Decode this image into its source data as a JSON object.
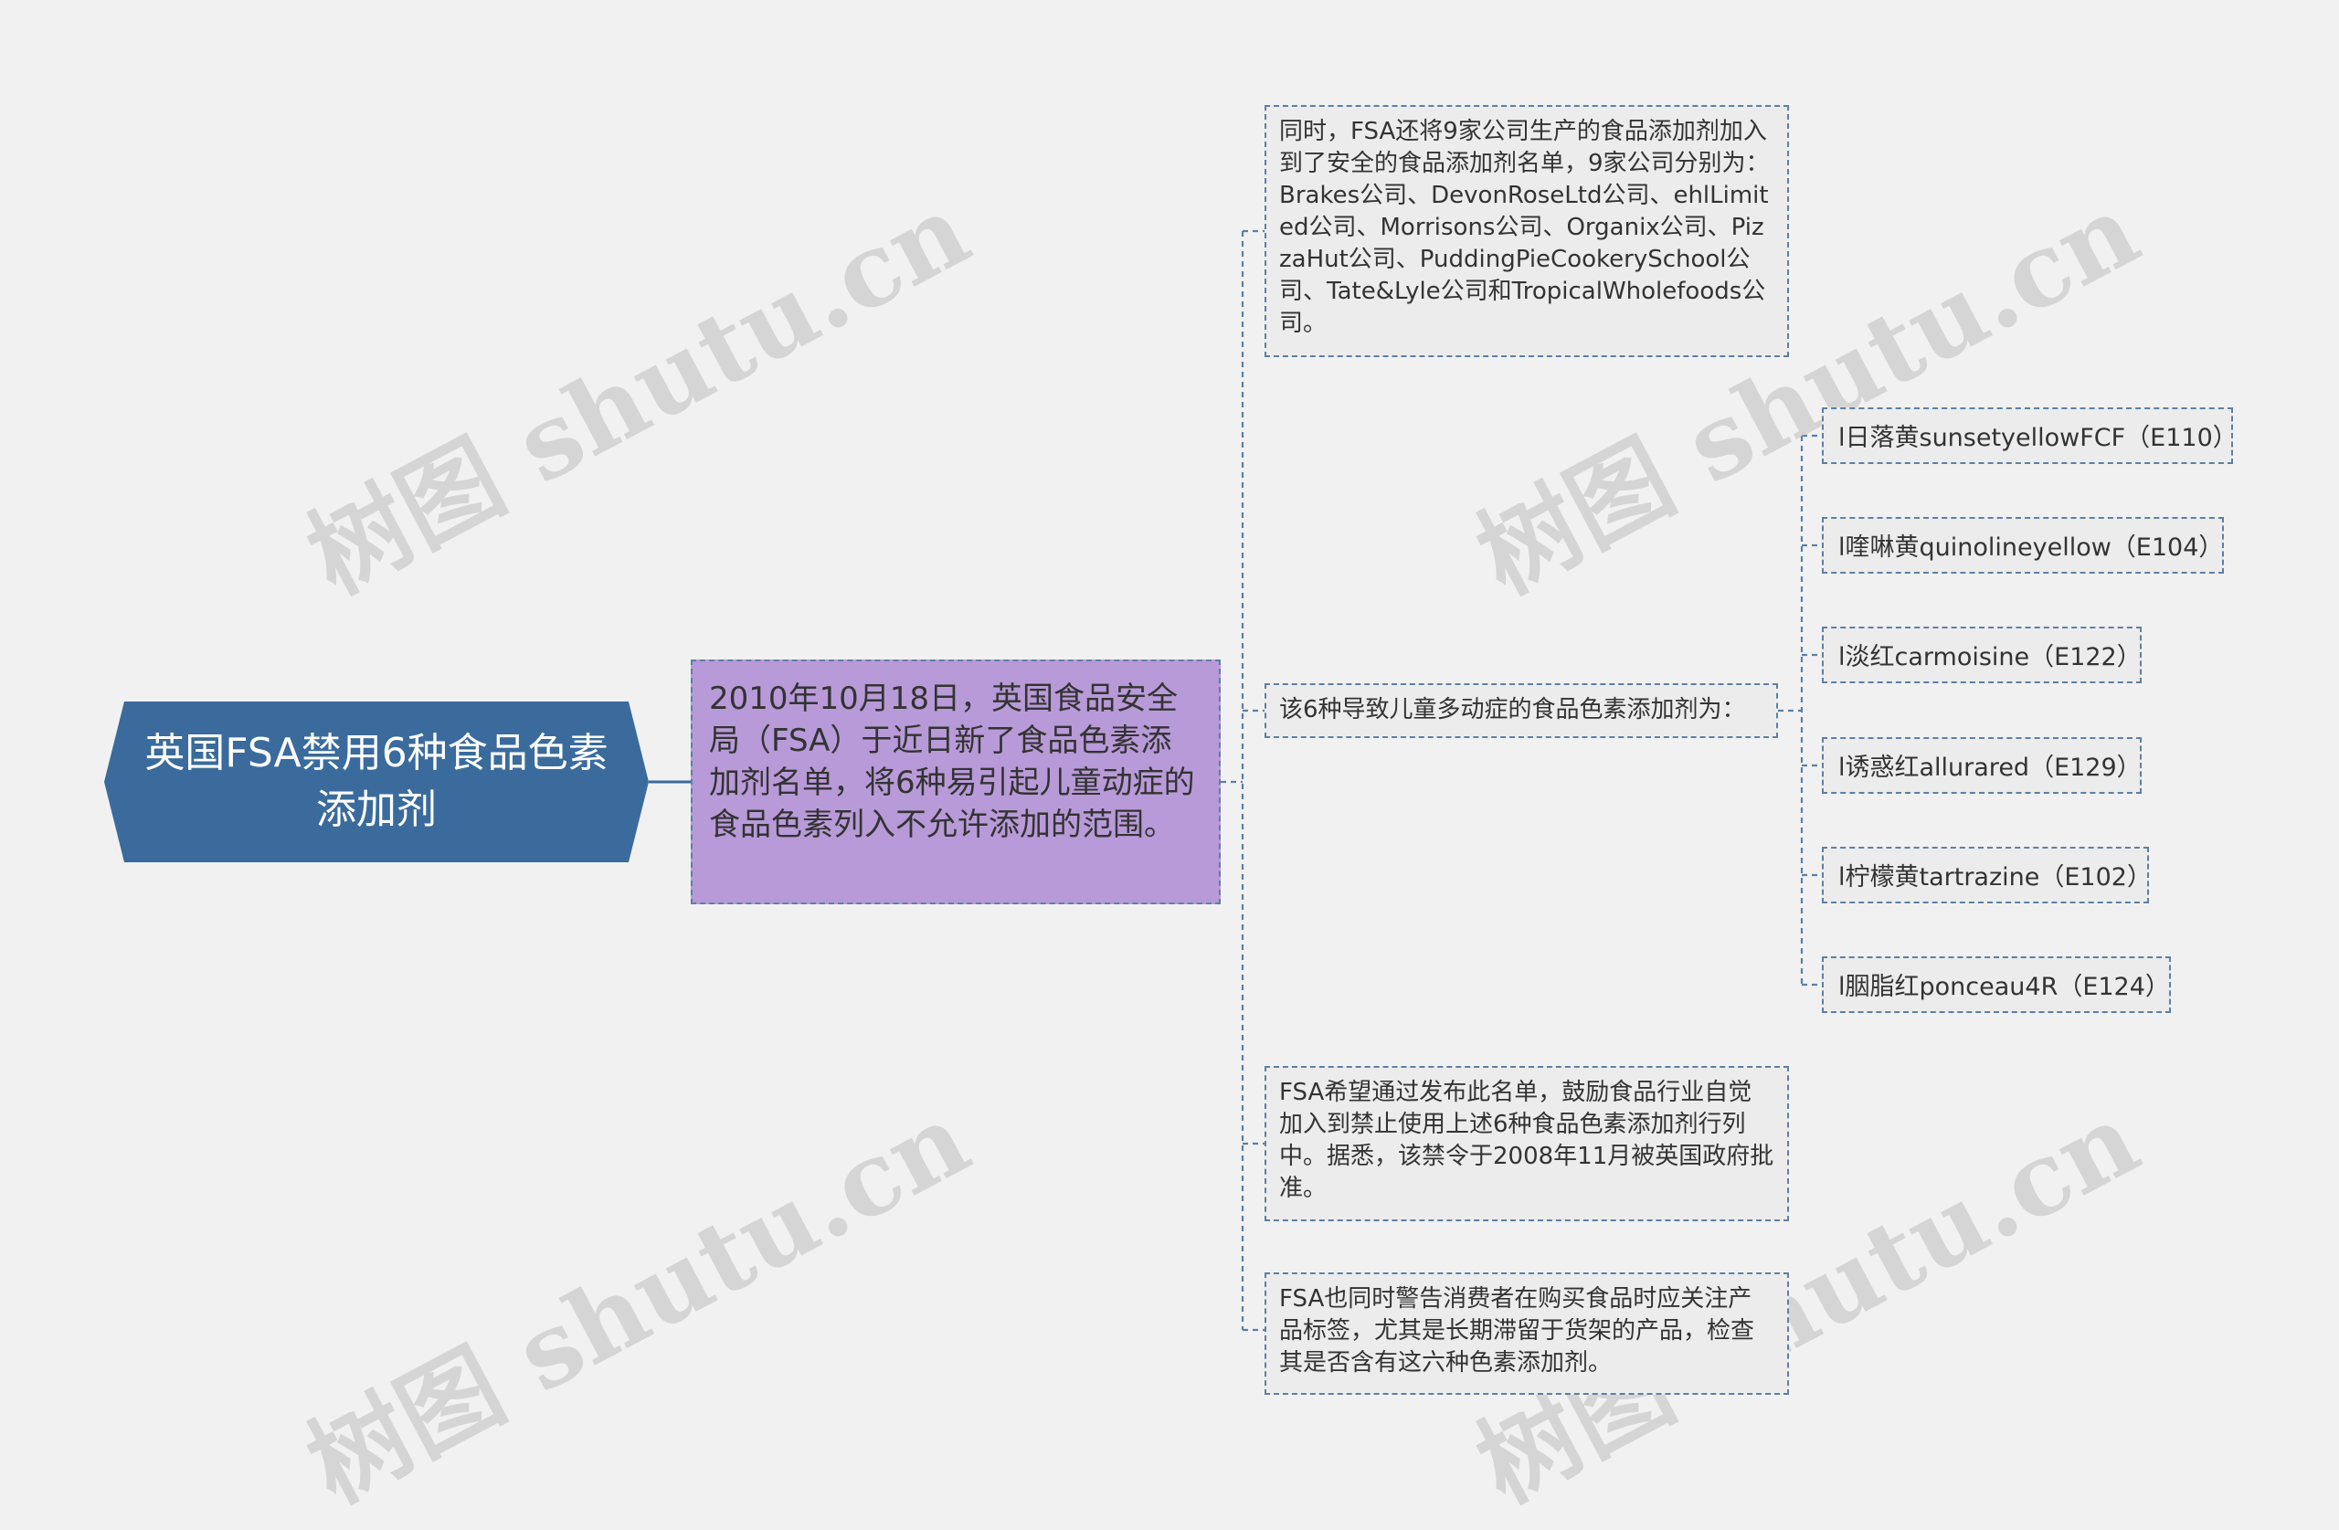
{
  "root": {
    "label": "英国FSA禁用6种食品色素添加剂"
  },
  "main": {
    "text": "2010年10月18日，英国食品安全局（FSA）于近日新了食品色素添加剂名单，将6种易引起儿童动症的食品色素列入不允许添加的范围。"
  },
  "branches": [
    {
      "text": "同时，FSA还将9家公司生产的食品添加剂加入到了安全的食品添加剂名单，9家公司分别为：Brakes公司、DevonRoseLtd公司、ehlLimited公司、Morrisons公司、Organix公司、PizzaHut公司、PuddingPieCookerySchool公司、Tate&Lyle公司和TropicalWholefoods公司。"
    },
    {
      "text": "该6种导致儿童多动症的食品色素添加剂为："
    },
    {
      "text": "FSA希望通过发布此名单，鼓励食品行业自觉加入到禁止使用上述6种食品色素添加剂行列中。据悉，该禁令于2008年11月被英国政府批准。"
    },
    {
      "text": "FSA也同时警告消费者在购买食品时应关注产品标签，尤其是长期滞留于货架的产品，检查其是否含有这六种色素添加剂。"
    }
  ],
  "additives": [
    {
      "label": "l日落黄sunsetyellowFCF（E110）"
    },
    {
      "label": "l喹啉黄quinolineyellow（E104）"
    },
    {
      "label": "l淡红carmoisine（E122）"
    },
    {
      "label": "l诱惑红allurared（E129）"
    },
    {
      "label": "l柠檬黄tartrazine（E102）"
    },
    {
      "label": "l胭脂红ponceau4R（E124）"
    }
  ],
  "watermark": "树图 shutu.cn",
  "colors": {
    "background": "#f1f1f1",
    "root_fill": "#3a6b9c",
    "main_fill": "#b89ad8",
    "node_fill": "#ececec",
    "link": "#5e7fa3"
  }
}
